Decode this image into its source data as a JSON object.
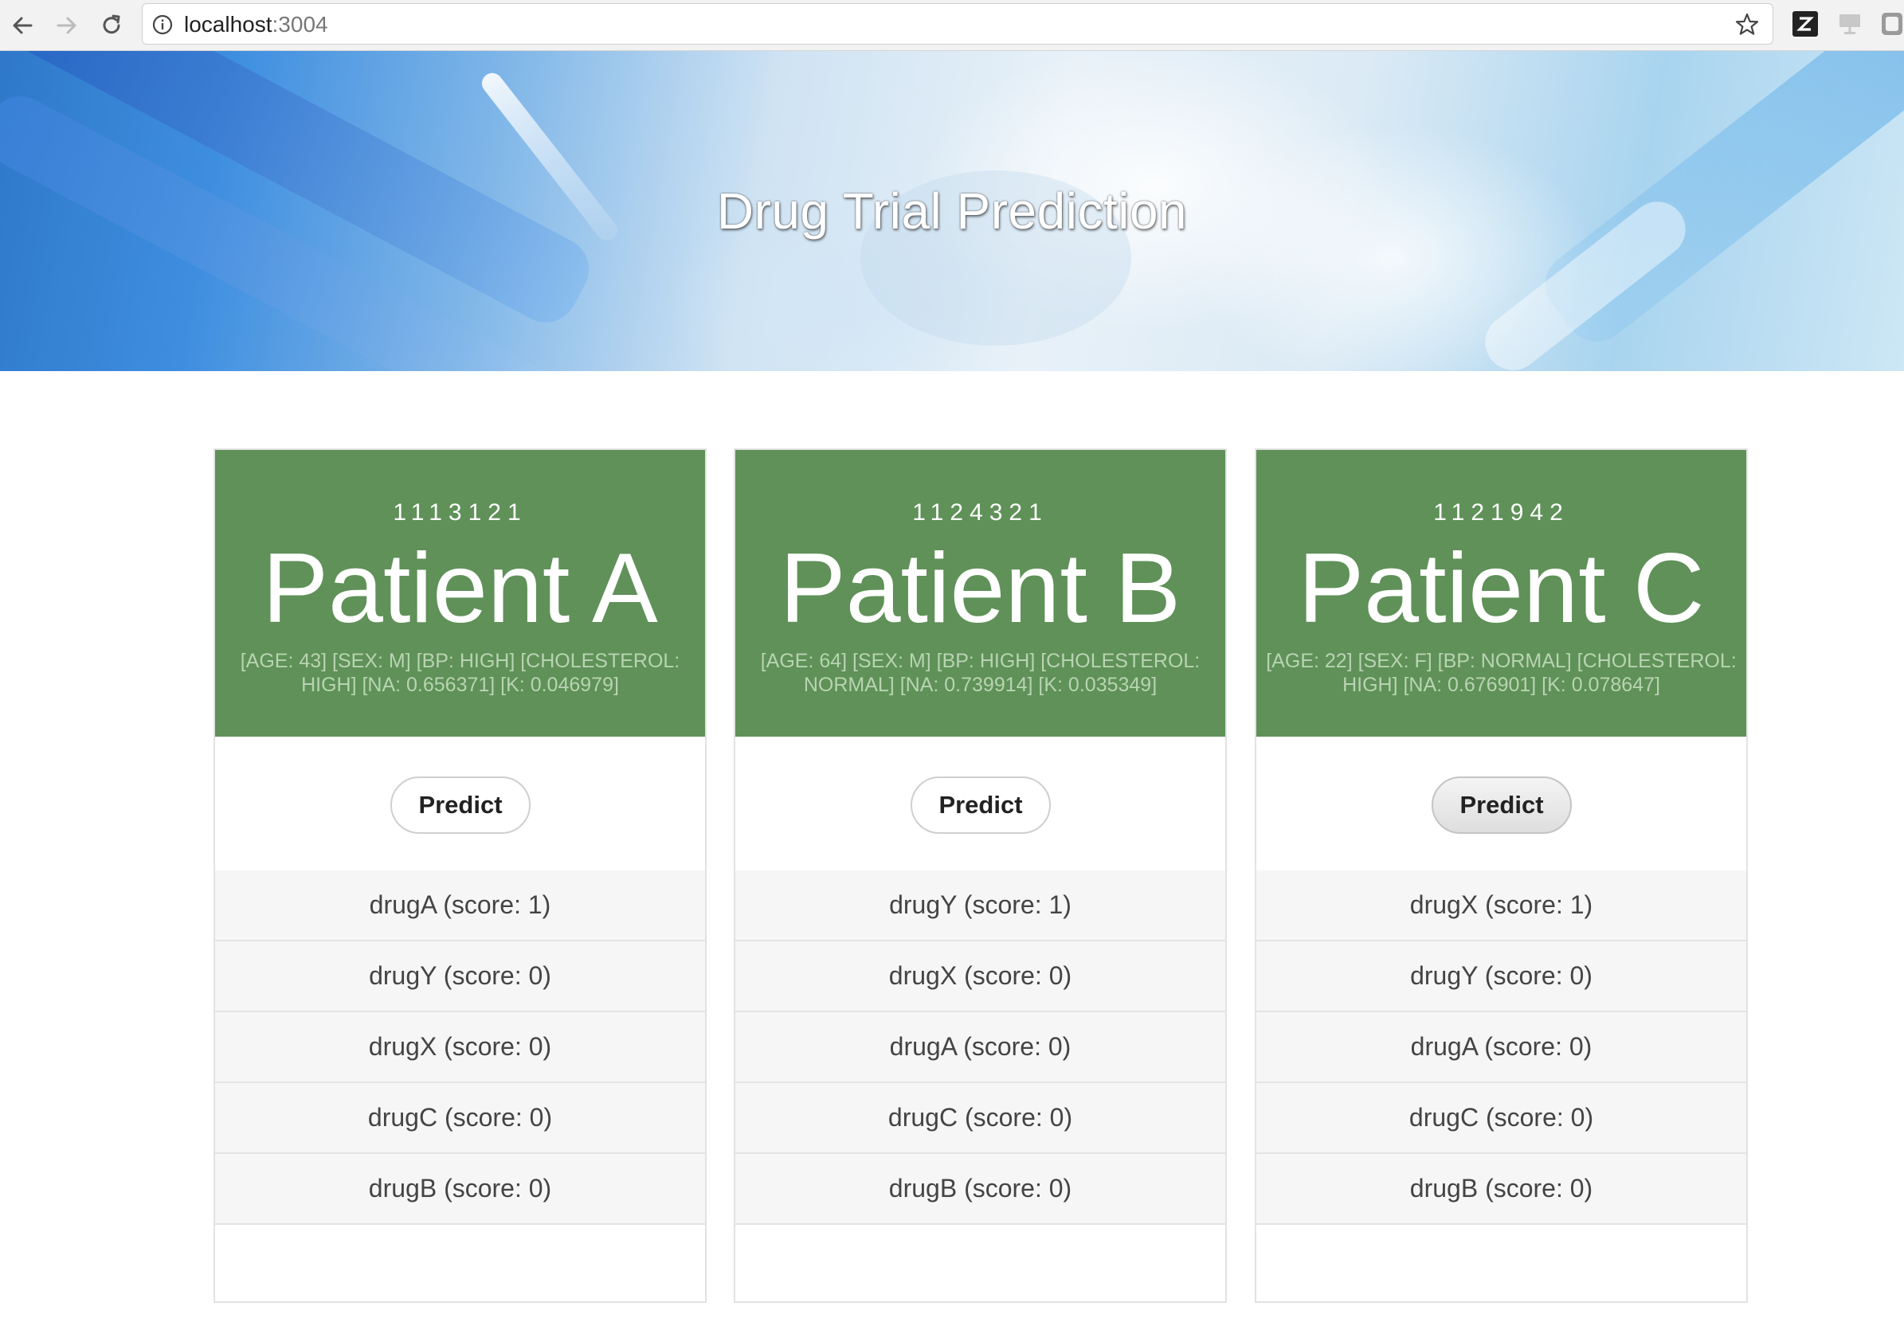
{
  "browser": {
    "url_host": "localhost",
    "url_port": ":3004",
    "back_icon": "arrow-left-icon",
    "forward_icon": "arrow-right-icon",
    "reload_icon": "reload-icon",
    "bookmark_icon": "star-icon"
  },
  "hero": {
    "title": "Drug Trial Prediction"
  },
  "patients": [
    {
      "id": "1113121",
      "name": "Patient A",
      "details": "[AGE: 43] [SEX: M] [BP: HIGH] [CHOLESTEROL: HIGH] [NA: 0.656371] [K: 0.046979]",
      "predict_label": "Predict",
      "drugs": [
        "drugA (score: 1)",
        "drugY (score: 0)",
        "drugX (score: 0)",
        "drugC (score: 0)",
        "drugB (score: 0)"
      ]
    },
    {
      "id": "1124321",
      "name": "Patient B",
      "details": "[AGE: 64] [SEX: M] [BP: HIGH] [CHOLESTEROL: NORMAL] [NA: 0.739914] [K: 0.035349]",
      "predict_label": "Predict",
      "drugs": [
        "drugY (score: 1)",
        "drugX (score: 0)",
        "drugA (score: 0)",
        "drugC (score: 0)",
        "drugB (score: 0)"
      ]
    },
    {
      "id": "1121942",
      "name": "Patient C",
      "details": "[AGE: 22] [SEX: F] [BP: NORMAL] [CHOLESTEROL: HIGH] [NA: 0.676901] [K: 0.078647]",
      "predict_label": "Predict",
      "drugs": [
        "drugX (score: 1)",
        "drugY (score: 0)",
        "drugA (score: 0)",
        "drugC (score: 0)",
        "drugB (score: 0)"
      ]
    }
  ],
  "colors": {
    "card_header": "#5f9158",
    "card_details": "#b8d4b2",
    "list_background": "#f6f6f6"
  }
}
